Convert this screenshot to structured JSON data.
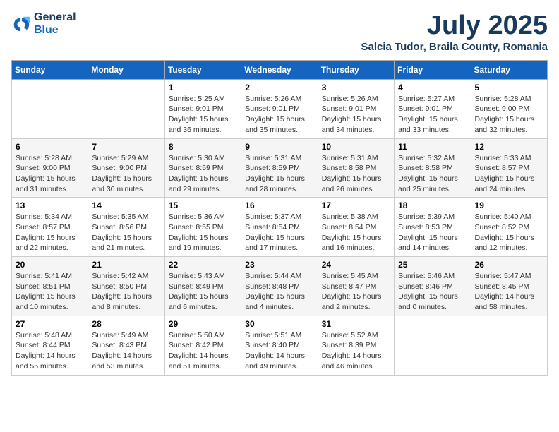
{
  "logo": {
    "line1": "General",
    "line2": "Blue"
  },
  "title": "July 2025",
  "location": "Salcia Tudor, Braila County, Romania",
  "days_of_week": [
    "Sunday",
    "Monday",
    "Tuesday",
    "Wednesday",
    "Thursday",
    "Friday",
    "Saturday"
  ],
  "weeks": [
    [
      {
        "day": null,
        "info": null
      },
      {
        "day": null,
        "info": null
      },
      {
        "day": "1",
        "info": "Sunrise: 5:25 AM\nSunset: 9:01 PM\nDaylight: 15 hours\nand 36 minutes."
      },
      {
        "day": "2",
        "info": "Sunrise: 5:26 AM\nSunset: 9:01 PM\nDaylight: 15 hours\nand 35 minutes."
      },
      {
        "day": "3",
        "info": "Sunrise: 5:26 AM\nSunset: 9:01 PM\nDaylight: 15 hours\nand 34 minutes."
      },
      {
        "day": "4",
        "info": "Sunrise: 5:27 AM\nSunset: 9:01 PM\nDaylight: 15 hours\nand 33 minutes."
      },
      {
        "day": "5",
        "info": "Sunrise: 5:28 AM\nSunset: 9:00 PM\nDaylight: 15 hours\nand 32 minutes."
      }
    ],
    [
      {
        "day": "6",
        "info": "Sunrise: 5:28 AM\nSunset: 9:00 PM\nDaylight: 15 hours\nand 31 minutes."
      },
      {
        "day": "7",
        "info": "Sunrise: 5:29 AM\nSunset: 9:00 PM\nDaylight: 15 hours\nand 30 minutes."
      },
      {
        "day": "8",
        "info": "Sunrise: 5:30 AM\nSunset: 8:59 PM\nDaylight: 15 hours\nand 29 minutes."
      },
      {
        "day": "9",
        "info": "Sunrise: 5:31 AM\nSunset: 8:59 PM\nDaylight: 15 hours\nand 28 minutes."
      },
      {
        "day": "10",
        "info": "Sunrise: 5:31 AM\nSunset: 8:58 PM\nDaylight: 15 hours\nand 26 minutes."
      },
      {
        "day": "11",
        "info": "Sunrise: 5:32 AM\nSunset: 8:58 PM\nDaylight: 15 hours\nand 25 minutes."
      },
      {
        "day": "12",
        "info": "Sunrise: 5:33 AM\nSunset: 8:57 PM\nDaylight: 15 hours\nand 24 minutes."
      }
    ],
    [
      {
        "day": "13",
        "info": "Sunrise: 5:34 AM\nSunset: 8:57 PM\nDaylight: 15 hours\nand 22 minutes."
      },
      {
        "day": "14",
        "info": "Sunrise: 5:35 AM\nSunset: 8:56 PM\nDaylight: 15 hours\nand 21 minutes."
      },
      {
        "day": "15",
        "info": "Sunrise: 5:36 AM\nSunset: 8:55 PM\nDaylight: 15 hours\nand 19 minutes."
      },
      {
        "day": "16",
        "info": "Sunrise: 5:37 AM\nSunset: 8:54 PM\nDaylight: 15 hours\nand 17 minutes."
      },
      {
        "day": "17",
        "info": "Sunrise: 5:38 AM\nSunset: 8:54 PM\nDaylight: 15 hours\nand 16 minutes."
      },
      {
        "day": "18",
        "info": "Sunrise: 5:39 AM\nSunset: 8:53 PM\nDaylight: 15 hours\nand 14 minutes."
      },
      {
        "day": "19",
        "info": "Sunrise: 5:40 AM\nSunset: 8:52 PM\nDaylight: 15 hours\nand 12 minutes."
      }
    ],
    [
      {
        "day": "20",
        "info": "Sunrise: 5:41 AM\nSunset: 8:51 PM\nDaylight: 15 hours\nand 10 minutes."
      },
      {
        "day": "21",
        "info": "Sunrise: 5:42 AM\nSunset: 8:50 PM\nDaylight: 15 hours\nand 8 minutes."
      },
      {
        "day": "22",
        "info": "Sunrise: 5:43 AM\nSunset: 8:49 PM\nDaylight: 15 hours\nand 6 minutes."
      },
      {
        "day": "23",
        "info": "Sunrise: 5:44 AM\nSunset: 8:48 PM\nDaylight: 15 hours\nand 4 minutes."
      },
      {
        "day": "24",
        "info": "Sunrise: 5:45 AM\nSunset: 8:47 PM\nDaylight: 15 hours\nand 2 minutes."
      },
      {
        "day": "25",
        "info": "Sunrise: 5:46 AM\nSunset: 8:46 PM\nDaylight: 15 hours\nand 0 minutes."
      },
      {
        "day": "26",
        "info": "Sunrise: 5:47 AM\nSunset: 8:45 PM\nDaylight: 14 hours\nand 58 minutes."
      }
    ],
    [
      {
        "day": "27",
        "info": "Sunrise: 5:48 AM\nSunset: 8:44 PM\nDaylight: 14 hours\nand 55 minutes."
      },
      {
        "day": "28",
        "info": "Sunrise: 5:49 AM\nSunset: 8:43 PM\nDaylight: 14 hours\nand 53 minutes."
      },
      {
        "day": "29",
        "info": "Sunrise: 5:50 AM\nSunset: 8:42 PM\nDaylight: 14 hours\nand 51 minutes."
      },
      {
        "day": "30",
        "info": "Sunrise: 5:51 AM\nSunset: 8:40 PM\nDaylight: 14 hours\nand 49 minutes."
      },
      {
        "day": "31",
        "info": "Sunrise: 5:52 AM\nSunset: 8:39 PM\nDaylight: 14 hours\nand 46 minutes."
      },
      {
        "day": null,
        "info": null
      },
      {
        "day": null,
        "info": null
      }
    ]
  ]
}
